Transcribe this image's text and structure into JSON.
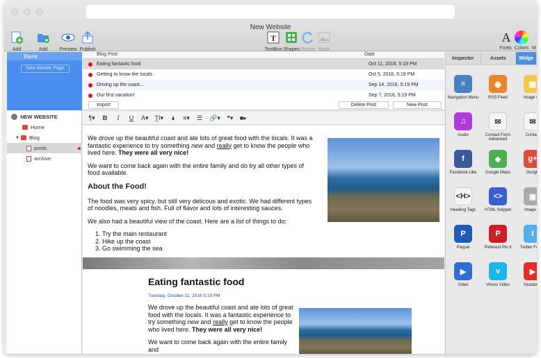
{
  "window": {
    "title": "New Website"
  },
  "toolbar": {
    "add_page": "Add Page",
    "add_directory": "Add Directory",
    "preview": "Preview",
    "publish": "Publish",
    "textbox": "TextBox",
    "shapes": "Shapes",
    "rotate": "Rotate",
    "mask": "Mask",
    "fonts": "Fonts",
    "colors": "Colors",
    "more": "M"
  },
  "master": {
    "blank": "Blank",
    "new_master": "New Master Page"
  },
  "tree": {
    "site": "NEW WEBSITE",
    "home": "Home",
    "blog": "Blog",
    "posts": "posts",
    "archive": "archive"
  },
  "posts_list": {
    "col_title": "Blog Post",
    "col_date": "Date",
    "rows": [
      {
        "title": "Eating fantastic food",
        "date": "Oct 11, 2016, 5:19 PM"
      },
      {
        "title": "Getting to know the locals",
        "date": "Oct 5, 2016, 5:19 PM"
      },
      {
        "title": "Driving up the coast...",
        "date": "Sep 14, 2016, 5:19 PM"
      },
      {
        "title": "Our first vacation!",
        "date": "Sep 7, 2016, 5:19 PM"
      }
    ],
    "import": "Import",
    "delete": "Delete Post",
    "new": "New Post"
  },
  "format_bar": [
    "¶▾",
    "B",
    "I",
    "U",
    "A▾",
    "T̲I▾",
    "🌢",
    "≡▾",
    "☰",
    "🔗▾",
    "❝▾",
    "■▸"
  ],
  "editor": {
    "p1_a": "We drove up the beautiful coast and ate lots of great food with the locals. It was a fantastic experience to try something ",
    "p1_new": "new",
    "p1_and": " and ",
    "p1_really": "really",
    "p1_b": " get to know the people who lived here. ",
    "p1_bold": "They were all very nice",
    "p1_end": "!",
    "p2": "We want to come back again with the entire family and do try all other types of food available.",
    "heading": "About the Food!",
    "p3": "The food was very spicy, but still very delicous and exotic. We had different types of noodles, meats and fish. Full of flavor and lots of interesting sauces.",
    "p4": "We also had a beautiful view of the coast. Here are a list of things to do;",
    "list": [
      "Try the main restaurant",
      "Hike up the coast",
      "Go swimming the sea"
    ]
  },
  "preview": {
    "title": "Eating fantastic food",
    "date": "Tuesday, October 11, 2016 5:19 PM",
    "p1_a": "We drove up the beautiful coast and ate lots of great food with the locals. It was a fantastic experience to try something ",
    "p1_new": "new",
    "p1_and": " and ",
    "p1_really": "really",
    "p1_b": " get to know the people who lived here. ",
    "p1_bold": "They were all very nice",
    "p1_end": "!",
    "p2": "We want to come back again with the entire family and"
  },
  "right_panel": {
    "tabs": [
      "Inspector",
      "Assets",
      "Widge"
    ],
    "widgets": [
      {
        "label": "Navigation Menu",
        "icon": "menu-icon",
        "color": "#4a7fc1",
        "glyph": "≡"
      },
      {
        "label": "RSS Feed",
        "icon": "rss-icon",
        "color": "#e8862e",
        "glyph": "◉"
      },
      {
        "label": "Image Ga",
        "icon": "gallery-icon",
        "color": "#f2c94c",
        "glyph": "▦"
      },
      {
        "label": "Audio",
        "icon": "audio-icon",
        "color": "#b03bd8",
        "glyph": "♫"
      },
      {
        "label": "Contact Form Advanced",
        "icon": "contact-form-icon",
        "color": "#f5f5f5",
        "glyph": "✉"
      },
      {
        "label": "Contact",
        "icon": "contact-icon",
        "color": "#f5f5f5",
        "glyph": "✉"
      },
      {
        "label": "Facebook Like",
        "icon": "facebook-icon",
        "color": "#3b5998",
        "glyph": "f"
      },
      {
        "label": "Google Maps",
        "icon": "maps-icon",
        "color": "#4caf50",
        "glyph": "◆"
      },
      {
        "label": "Google",
        "icon": "google-icon",
        "color": "#dd4b39",
        "glyph": "g+"
      },
      {
        "label": "Heading Tags",
        "icon": "heading-icon",
        "color": "#f5f5f5",
        "glyph": "<H>"
      },
      {
        "label": "HTML Snippet",
        "icon": "html-icon",
        "color": "#3a5fcd",
        "glyph": "<>"
      },
      {
        "label": "Image Sl",
        "icon": "slider-icon",
        "color": "#aaaaaa",
        "glyph": "▣"
      },
      {
        "label": "Paypal",
        "icon": "paypal-icon",
        "color": "#1f5bb8",
        "glyph": "P"
      },
      {
        "label": "Pinterest Pin It",
        "icon": "pinterest-icon",
        "color": "#cb2027",
        "glyph": "P"
      },
      {
        "label": "Twitter Fo Me",
        "icon": "twitter-icon",
        "color": "#55acee",
        "glyph": "t"
      },
      {
        "label": "Video",
        "icon": "video-icon",
        "color": "#2f6fd1",
        "glyph": "▶"
      },
      {
        "label": "Vimeo Video",
        "icon": "vimeo-icon",
        "color": "#1ab7ea",
        "glyph": "v"
      },
      {
        "label": "Youtube V",
        "icon": "youtube-icon",
        "color": "#e52d27",
        "glyph": "▶"
      }
    ]
  }
}
